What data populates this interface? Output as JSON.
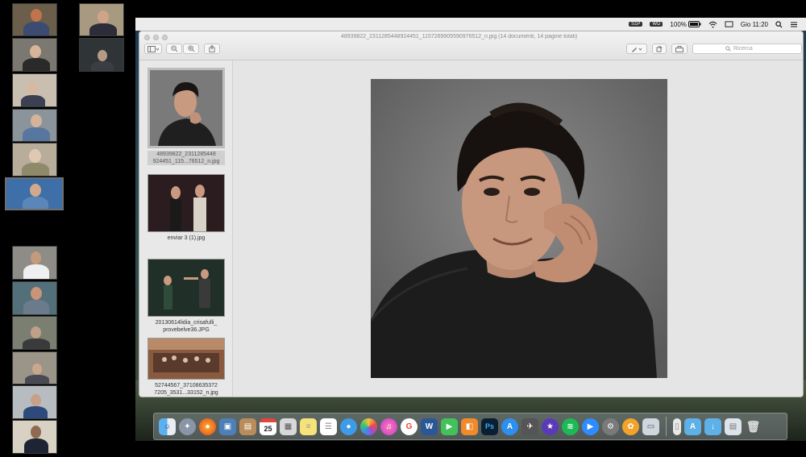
{
  "menubar": {
    "siri_badge": "S1P",
    "wd_badge": "WD",
    "battery": "100%",
    "clock": "Gio 11:20"
  },
  "window": {
    "title": "48939822_2311285448924451_1157269905590976512_n.jpg (14 documenti, 14 pagine totali)",
    "search_placeholder": "Ricerca"
  },
  "sidebar": {
    "items": [
      {
        "label": "48939822_2311285448 924451_115...76512_n.jpg",
        "selected": true
      },
      {
        "label": "enviar 3 (1).jpg",
        "selected": false
      },
      {
        "label": "20130614lidia_crisafulli_ provebelve36.JPG",
        "selected": false
      },
      {
        "label": "52744567_37108635372 7205_3531...33152_n.jpg",
        "selected": false
      }
    ]
  },
  "dock": {
    "calendar_day": "25",
    "word_label": "W",
    "photoshop_label": "Ps"
  },
  "colors": {
    "desktop": "#2f4a4d",
    "window_bg": "#e6e6e6",
    "sidebar_bg": "#e8e8e8",
    "selection": "#cfcfcf"
  }
}
